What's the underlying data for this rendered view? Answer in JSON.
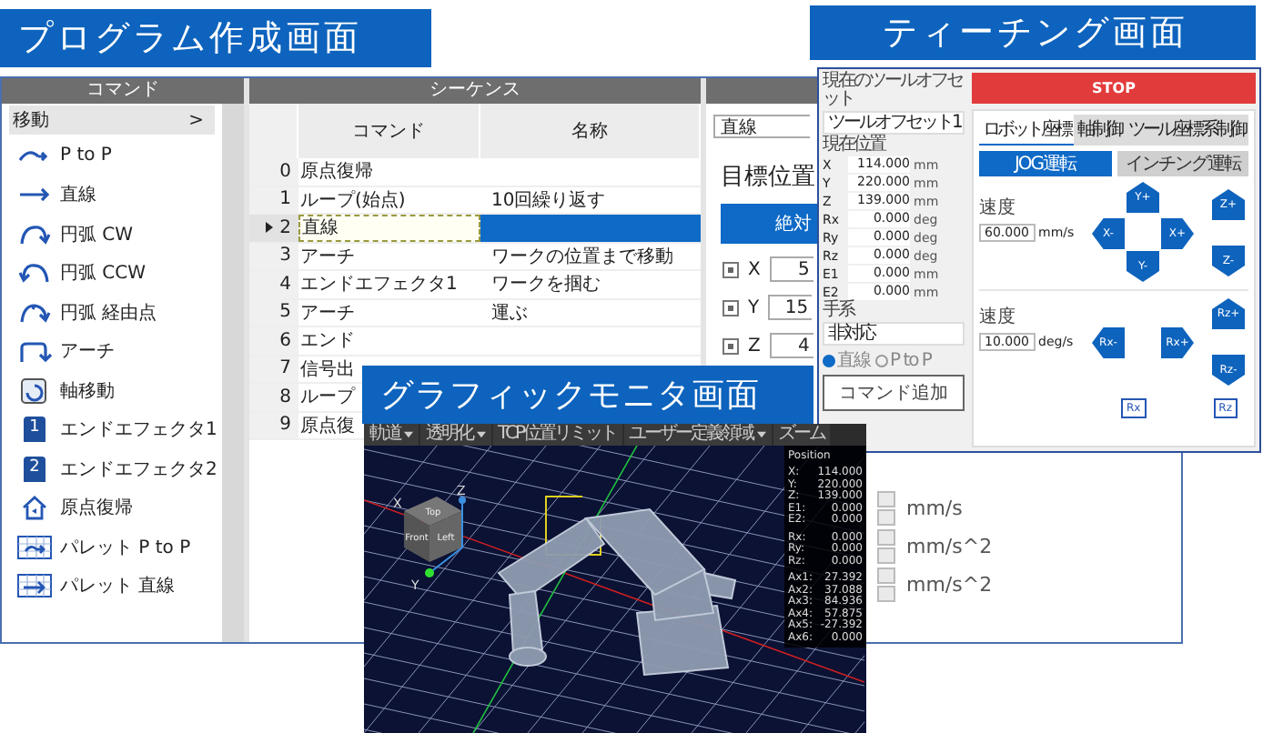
{
  "program_window": {
    "banner": "プログラム作成画面",
    "command_panel": {
      "header": "コマンド",
      "group": {
        "label": "移動",
        "arrow": ">"
      },
      "items": [
        {
          "label": "P to P",
          "kind": "ptp"
        },
        {
          "label": "直線",
          "kind": "line"
        },
        {
          "label": "円弧 CW",
          "kind": "arc_cw"
        },
        {
          "label": "円弧 CCW",
          "kind": "arc_ccw"
        },
        {
          "label": "円弧 経由点",
          "kind": "arc_via"
        },
        {
          "label": "アーチ",
          "kind": "arch"
        },
        {
          "label": "軸移動",
          "kind": "axis"
        },
        {
          "label": "エンドエフェクタ1",
          "kind": "effector",
          "badge": "1"
        },
        {
          "label": "エンドエフェクタ2",
          "kind": "effector",
          "badge": "2"
        },
        {
          "label": "原点復帰",
          "kind": "home"
        },
        {
          "label": "パレット P to P",
          "kind": "pallet_ptp"
        },
        {
          "label": "パレット 直線",
          "kind": "pallet_line"
        }
      ]
    },
    "sequence": {
      "header": "シーケンス",
      "columns": [
        "コマンド",
        "名称"
      ],
      "rows": [
        {
          "index": "0",
          "command": "原点復帰",
          "name": "",
          "selected": false
        },
        {
          "index": "1",
          "command": "ループ(始点)",
          "name": "10回繰り返す",
          "selected": false
        },
        {
          "index": "2",
          "command": "直線",
          "name": "",
          "selected": true
        },
        {
          "index": "3",
          "command": "アーチ",
          "name": "ワークの位置まで移動",
          "selected": false
        },
        {
          "index": "4",
          "command": "エンドエフェクタ1",
          "name": "ワークを掴む",
          "selected": false
        },
        {
          "index": "5",
          "command": "アーチ",
          "name": "運ぶ",
          "selected": false
        },
        {
          "index": "6",
          "command": "エンド",
          "name": "",
          "selected": false
        },
        {
          "index": "7",
          "command": "信号出",
          "name": "",
          "selected": false
        },
        {
          "index": "8",
          "command": "ループ",
          "name": "",
          "selected": false
        },
        {
          "index": "9",
          "command": "原点復",
          "name": "",
          "selected": false
        }
      ]
    },
    "parameters": {
      "type_select": "直線",
      "section_title": "目標位置",
      "mode_button": "絶対",
      "axes": [
        {
          "label": "X",
          "value": "5",
          "checked": true
        },
        {
          "label": "Y",
          "value": "15",
          "checked": true
        },
        {
          "label": "Z",
          "value": "4",
          "checked": true
        }
      ],
      "units": [
        "mm/s",
        "mm/s^2",
        "mm/s^2"
      ]
    }
  },
  "teaching_window": {
    "banner": "ティーチング画面",
    "tool_offset": {
      "label": "現在のツールオフセット",
      "value": "ツールオフセット1"
    },
    "position": {
      "label": "現在位置",
      "rows": [
        {
          "axis": "X",
          "value": "114.000",
          "unit": "mm"
        },
        {
          "axis": "Y",
          "value": "220.000",
          "unit": "mm"
        },
        {
          "axis": "Z",
          "value": "139.000",
          "unit": "mm"
        },
        {
          "axis": "Rx",
          "value": "0.000",
          "unit": "deg"
        },
        {
          "axis": "Ry",
          "value": "0.000",
          "unit": "deg"
        },
        {
          "axis": "Rz",
          "value": "0.000",
          "unit": "deg"
        },
        {
          "axis": "E1",
          "value": "0.000",
          "unit": "mm"
        },
        {
          "axis": "E2",
          "value": "0.000",
          "unit": "mm"
        }
      ]
    },
    "hand": {
      "label": "手系",
      "value": "非対応"
    },
    "radios": [
      {
        "label": "直線",
        "selected": true
      },
      {
        "label": "P to P",
        "selected": false
      }
    ],
    "add_button": "コマンド追加",
    "stop_button": "STOP",
    "tabs": [
      {
        "label": "ロボット座標",
        "selected": true
      },
      {
        "label": "軸制御",
        "selected": false
      },
      {
        "label": "ツール座標系制御",
        "selected": false
      }
    ],
    "modes": [
      {
        "label": "JOG運転",
        "selected": true
      },
      {
        "label": "インチング運転",
        "selected": false
      }
    ],
    "jogs": [
      {
        "speed_label": "速度",
        "speed": "60.000",
        "unit": "mm/s",
        "pad": {
          "up": "Y+",
          "left": "X-",
          "right": "X+",
          "down": "Y-"
        },
        "side": {
          "up": "Z+",
          "down": "Z-"
        }
      },
      {
        "speed_label": "速度",
        "speed": "10.000",
        "unit": "deg/s",
        "pad": {
          "left": "Rx-",
          "right": "Rx+"
        },
        "side": {
          "up": "Rz+",
          "down": "Rz-"
        },
        "home": [
          "Rx",
          "Rz"
        ]
      }
    ]
  },
  "monitor_window": {
    "banner": "グラフィックモニタ画面",
    "toolbar": [
      {
        "label": "軌道",
        "dropdown": true
      },
      {
        "label": "透明化",
        "dropdown": true
      },
      {
        "label": "TCP位置リミット",
        "dropdown": false
      },
      {
        "label": "ユーザー定義領域",
        "dropdown": true
      },
      {
        "label": "ズーム",
        "dropdown": false
      }
    ],
    "view_cube": {
      "faces": [
        "Top",
        "Front",
        "Left"
      ],
      "axes": [
        "X",
        "Y",
        "Z"
      ]
    },
    "overlay": {
      "title": "Position",
      "groups": [
        [
          {
            "label": "X:",
            "value": "114.000"
          },
          {
            "label": "Y:",
            "value": "220.000"
          },
          {
            "label": "Z:",
            "value": "139.000"
          },
          {
            "label": "E1:",
            "value": "0.000"
          },
          {
            "label": "E2:",
            "value": "0.000"
          }
        ],
        [
          {
            "label": "Rx:",
            "value": "0.000"
          },
          {
            "label": "Ry:",
            "value": "0.000"
          },
          {
            "label": "Rz:",
            "value": "0.000"
          }
        ],
        [
          {
            "label": "Ax1:",
            "value": "27.392"
          },
          {
            "label": "Ax2:",
            "value": "37.088"
          },
          {
            "label": "Ax3:",
            "value": "84.936"
          },
          {
            "label": "Ax4:",
            "value": "57.875"
          },
          {
            "label": "Ax5:",
            "value": "-27.392"
          },
          {
            "label": "Ax6:",
            "value": "0.000"
          }
        ]
      ]
    }
  }
}
